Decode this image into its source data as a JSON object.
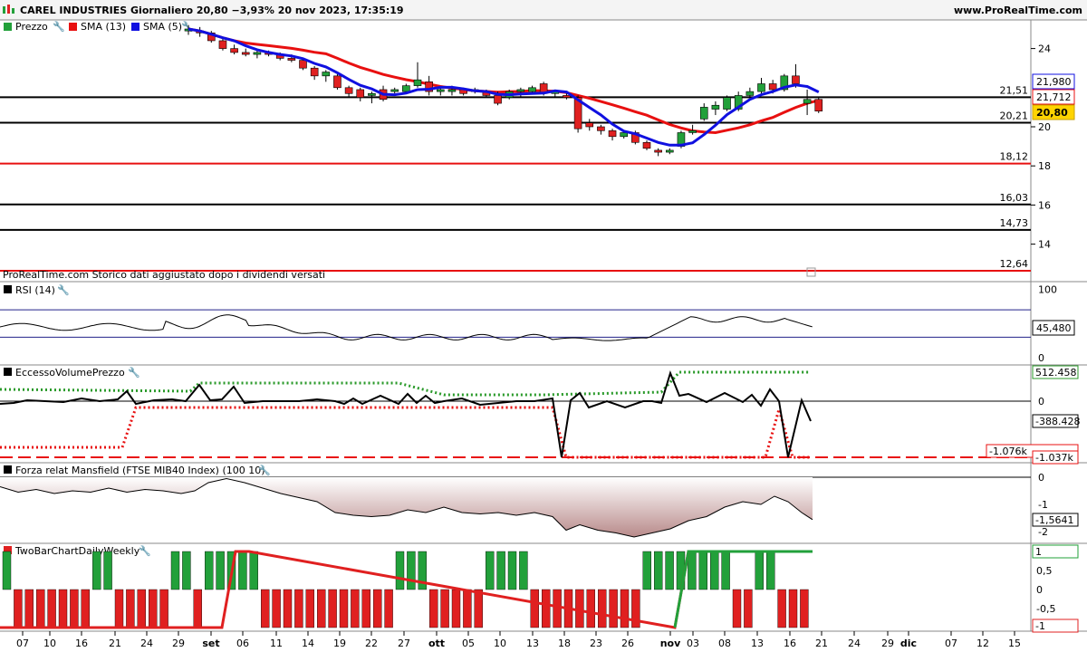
{
  "header": {
    "title": "CAREL INDUSTRIES Giornaliero 20,80 −3,93% 20 nov 2023, 17:35:19",
    "site": "www.ProRealTime.com"
  },
  "colors": {
    "up": "#22a03a",
    "down": "#e02020",
    "sma13": "#e81010",
    "sma5": "#1010e0",
    "dotted_green": "#2a9a2a",
    "dotted_red": "#e81010",
    "black": "#000000"
  },
  "chart_data": [
    {
      "type": "candlestick",
      "title": "Prezzo",
      "legend": [
        "Prezzo",
        "SMA (13)",
        "SMA (5)"
      ],
      "y_ticks": [
        "24",
        "20",
        "18",
        "16",
        "14"
      ],
      "ylim": [
        12,
        25
      ],
      "x_ticks": [
        "07",
        "10",
        "16",
        "21",
        "24",
        "29",
        "set",
        "06",
        "11",
        "14",
        "19",
        "22",
        "27",
        "ott",
        "05",
        "10",
        "13",
        "18",
        "23",
        "26",
        "nov",
        "03",
        "08",
        "13",
        "16",
        "21",
        "24",
        "29",
        "dic",
        "07",
        "12",
        "15"
      ],
      "candles": [
        {
          "x": "2023-08-29",
          "o": 24.9,
          "h": 25.2,
          "l": 24.7,
          "c": 25.0
        },
        {
          "x": "2023-09-04",
          "o": 24.9,
          "h": 25.1,
          "l": 24.6,
          "c": 24.8
        },
        {
          "x": "2023-09-05",
          "o": 24.8,
          "h": 24.9,
          "l": 24.3,
          "c": 24.4
        },
        {
          "x": "2023-09-06",
          "o": 24.4,
          "h": 24.5,
          "l": 23.9,
          "c": 24.0
        },
        {
          "x": "2023-09-07",
          "o": 24.0,
          "h": 24.2,
          "l": 23.7,
          "c": 23.8
        },
        {
          "x": "2023-09-08",
          "o": 23.8,
          "h": 24.0,
          "l": 23.6,
          "c": 23.7
        },
        {
          "x": "2023-09-11",
          "o": 23.7,
          "h": 23.9,
          "l": 23.5,
          "c": 23.8
        },
        {
          "x": "2023-09-12",
          "o": 23.8,
          "h": 23.9,
          "l": 23.6,
          "c": 23.7
        },
        {
          "x": "2023-09-13",
          "o": 23.7,
          "h": 23.8,
          "l": 23.4,
          "c": 23.5
        },
        {
          "x": "2023-09-14",
          "o": 23.5,
          "h": 23.7,
          "l": 23.3,
          "c": 23.4
        },
        {
          "x": "2023-09-15",
          "o": 23.4,
          "h": 23.5,
          "l": 22.9,
          "c": 23.0
        },
        {
          "x": "2023-09-18",
          "o": 23.0,
          "h": 23.1,
          "l": 22.4,
          "c": 22.6
        },
        {
          "x": "2023-09-19",
          "o": 22.6,
          "h": 22.9,
          "l": 22.3,
          "c": 22.8
        },
        {
          "x": "2023-09-20",
          "o": 22.6,
          "h": 22.7,
          "l": 21.9,
          "c": 22.0
        },
        {
          "x": "2023-09-21",
          "o": 22.0,
          "h": 22.1,
          "l": 21.5,
          "c": 21.7
        },
        {
          "x": "2023-09-22",
          "o": 21.9,
          "h": 22.0,
          "l": 21.3,
          "c": 21.5
        },
        {
          "x": "2023-09-25",
          "o": 21.6,
          "h": 21.8,
          "l": 21.2,
          "c": 21.7
        },
        {
          "x": "2023-09-26",
          "o": 21.9,
          "h": 22.1,
          "l": 21.3,
          "c": 21.4
        },
        {
          "x": "2023-09-27",
          "o": 21.8,
          "h": 22.0,
          "l": 21.7,
          "c": 21.9
        },
        {
          "x": "2023-09-28",
          "o": 21.8,
          "h": 22.2,
          "l": 21.7,
          "c": 22.1
        },
        {
          "x": "2023-09-29",
          "o": 22.1,
          "h": 23.3,
          "l": 22.0,
          "c": 22.4
        },
        {
          "x": "2023-10-02",
          "o": 22.3,
          "h": 22.6,
          "l": 21.6,
          "c": 21.8
        },
        {
          "x": "2023-10-03",
          "o": 21.8,
          "h": 22.0,
          "l": 21.6,
          "c": 21.9
        },
        {
          "x": "2023-10-04",
          "o": 21.8,
          "h": 22.1,
          "l": 21.6,
          "c": 21.9
        },
        {
          "x": "2023-10-05",
          "o": 21.9,
          "h": 22.0,
          "l": 21.6,
          "c": 21.7
        },
        {
          "x": "2023-10-06",
          "o": 21.8,
          "h": 22.0,
          "l": 21.7,
          "c": 21.9
        },
        {
          "x": "2023-10-09",
          "o": 21.8,
          "h": 21.9,
          "l": 21.5,
          "c": 21.6
        },
        {
          "x": "2023-10-10",
          "o": 21.6,
          "h": 21.8,
          "l": 21.1,
          "c": 21.2
        },
        {
          "x": "2023-10-11",
          "o": 21.5,
          "h": 21.9,
          "l": 21.4,
          "c": 21.8
        },
        {
          "x": "2023-10-12",
          "o": 21.8,
          "h": 22.0,
          "l": 21.5,
          "c": 21.9
        },
        {
          "x": "2023-10-13",
          "o": 21.8,
          "h": 22.1,
          "l": 21.7,
          "c": 22.0
        },
        {
          "x": "2023-10-16",
          "o": 22.2,
          "h": 22.3,
          "l": 21.6,
          "c": 21.7
        },
        {
          "x": "2023-10-17",
          "o": 21.7,
          "h": 21.9,
          "l": 21.5,
          "c": 21.8
        },
        {
          "x": "2023-10-18",
          "o": 21.6,
          "h": 21.8,
          "l": 21.4,
          "c": 21.5
        },
        {
          "x": "2023-10-19",
          "o": 21.5,
          "h": 21.6,
          "l": 19.7,
          "c": 19.9
        },
        {
          "x": "2023-10-20",
          "o": 20.2,
          "h": 20.4,
          "l": 19.8,
          "c": 20.0
        },
        {
          "x": "2023-10-23",
          "o": 20.0,
          "h": 20.1,
          "l": 19.6,
          "c": 19.8
        },
        {
          "x": "2023-10-24",
          "o": 19.8,
          "h": 19.9,
          "l": 19.3,
          "c": 19.5
        },
        {
          "x": "2023-10-25",
          "o": 19.5,
          "h": 19.8,
          "l": 19.4,
          "c": 19.7
        },
        {
          "x": "2023-10-26",
          "o": 19.7,
          "h": 19.8,
          "l": 19.1,
          "c": 19.2
        },
        {
          "x": "2023-10-27",
          "o": 19.2,
          "h": 19.3,
          "l": 18.8,
          "c": 18.9
        },
        {
          "x": "2023-10-30",
          "o": 18.8,
          "h": 18.9,
          "l": 18.5,
          "c": 18.7
        },
        {
          "x": "2023-10-31",
          "o": 18.7,
          "h": 18.9,
          "l": 18.6,
          "c": 18.8
        },
        {
          "x": "2023-11-02",
          "o": 19.0,
          "h": 19.8,
          "l": 18.9,
          "c": 19.7
        },
        {
          "x": "2023-11-03",
          "o": 19.7,
          "h": 20.1,
          "l": 19.6,
          "c": 19.8
        },
        {
          "x": "2023-11-06",
          "o": 20.4,
          "h": 21.2,
          "l": 20.3,
          "c": 21.0
        },
        {
          "x": "2023-11-07",
          "o": 20.9,
          "h": 21.3,
          "l": 20.6,
          "c": 21.1
        },
        {
          "x": "2023-11-08",
          "o": 20.9,
          "h": 21.6,
          "l": 20.8,
          "c": 21.5
        },
        {
          "x": "2023-11-09",
          "o": 20.9,
          "h": 21.8,
          "l": 20.8,
          "c": 21.6
        },
        {
          "x": "2023-11-10",
          "o": 21.6,
          "h": 22.0,
          "l": 21.5,
          "c": 21.8
        },
        {
          "x": "2023-11-13",
          "o": 21.8,
          "h": 22.5,
          "l": 21.7,
          "c": 22.2
        },
        {
          "x": "2023-11-14",
          "o": 22.2,
          "h": 22.4,
          "l": 21.7,
          "c": 21.9
        },
        {
          "x": "2023-11-15",
          "o": 21.9,
          "h": 22.7,
          "l": 21.8,
          "c": 22.6
        },
        {
          "x": "2023-11-16",
          "o": 22.6,
          "h": 23.2,
          "l": 22.0,
          "c": 22.2
        },
        {
          "x": "2023-11-17",
          "o": 21.2,
          "h": 21.9,
          "l": 20.6,
          "c": 21.4
        },
        {
          "x": "2023-11-20",
          "o": 21.4,
          "h": 21.5,
          "l": 20.7,
          "c": 20.8
        }
      ],
      "sma13_label": "SMA (13)",
      "sma5_label": "SMA (5)",
      "price_labels": {
        "sma5": "21,980",
        "sma13": "21,712",
        "last": "20,80"
      },
      "hlines": [
        {
          "value": 21.51,
          "label": "21,51",
          "color": "#000000"
        },
        {
          "value": 20.21,
          "label": "20,21",
          "color": "#000000"
        },
        {
          "value": 18.12,
          "label": "18,12",
          "color": "#e81010"
        },
        {
          "value": 16.03,
          "label": "16,03",
          "color": "#000000"
        },
        {
          "value": 14.73,
          "label": "14,73",
          "color": "#000000"
        },
        {
          "value": 12.64,
          "label": "12,64",
          "color": "#e81010"
        }
      ],
      "note": "ProRealTime.com  Storico dati aggiustato dopo i dividendi versati"
    },
    {
      "type": "line",
      "title": "RSI (14)",
      "y_ticks": [
        "100",
        "0"
      ],
      "ylim": [
        0,
        100
      ],
      "last_label": "45,480"
    },
    {
      "type": "line",
      "title": "EccessoVolumePrezzo",
      "y_ticks": [
        "0"
      ],
      "labels": {
        "green": "512.458",
        "black": "-388.428",
        "red1": "-1.076k",
        "red2": "-1.037k"
      }
    },
    {
      "type": "area",
      "title": "Forza relat Mansfield (FTSE MIB40 Index) (100 10)",
      "y_ticks": [
        "0",
        "-1",
        "-2"
      ],
      "ylim": [
        -2.2,
        0.2
      ],
      "last_label": "-1,5641"
    },
    {
      "type": "bar",
      "title": "TwoBarChartDailyWeekly",
      "y_ticks": [
        "0,5",
        "0",
        "-0,5"
      ],
      "labels": {
        "top": "1",
        "bottom": "-1"
      }
    }
  ]
}
